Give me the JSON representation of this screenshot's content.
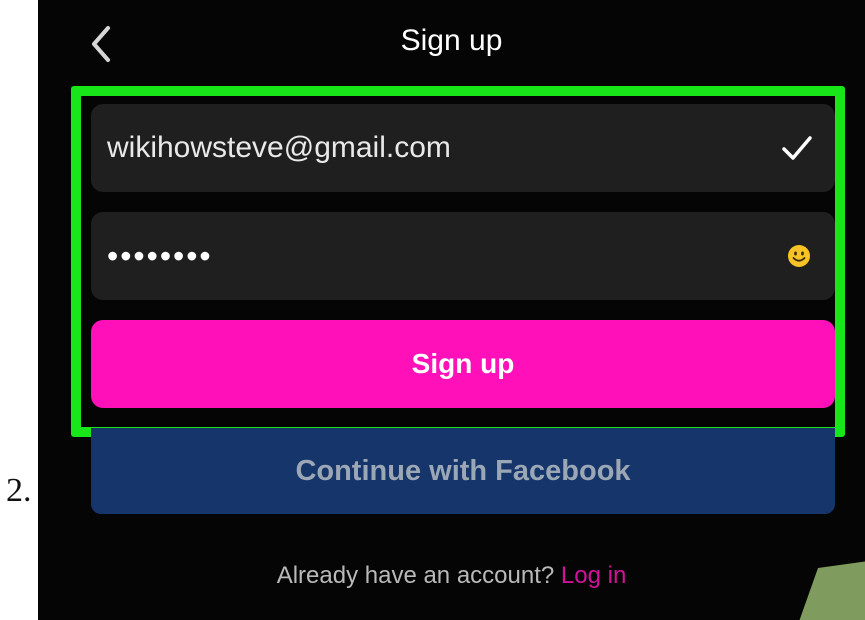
{
  "step": {
    "number": "2."
  },
  "header": {
    "back_icon": "chevron-left-icon",
    "title": "Sign up"
  },
  "form": {
    "email": {
      "value": "wikihowsteve@gmail.com",
      "status_icon": "checkmark-icon"
    },
    "password": {
      "masked_value": "••••••••",
      "accessory_icon": "smiley-emoji-icon"
    },
    "signup_button_label": "Sign up",
    "facebook_button_label": "Continue with Facebook",
    "login_prompt": "Already have an account?",
    "login_link": "Log in"
  },
  "colors": {
    "highlight": "#19e619",
    "signup_button": "#ff10b9",
    "facebook_button": "#15356b",
    "login_link": "#d4109a",
    "background": "#050505"
  }
}
